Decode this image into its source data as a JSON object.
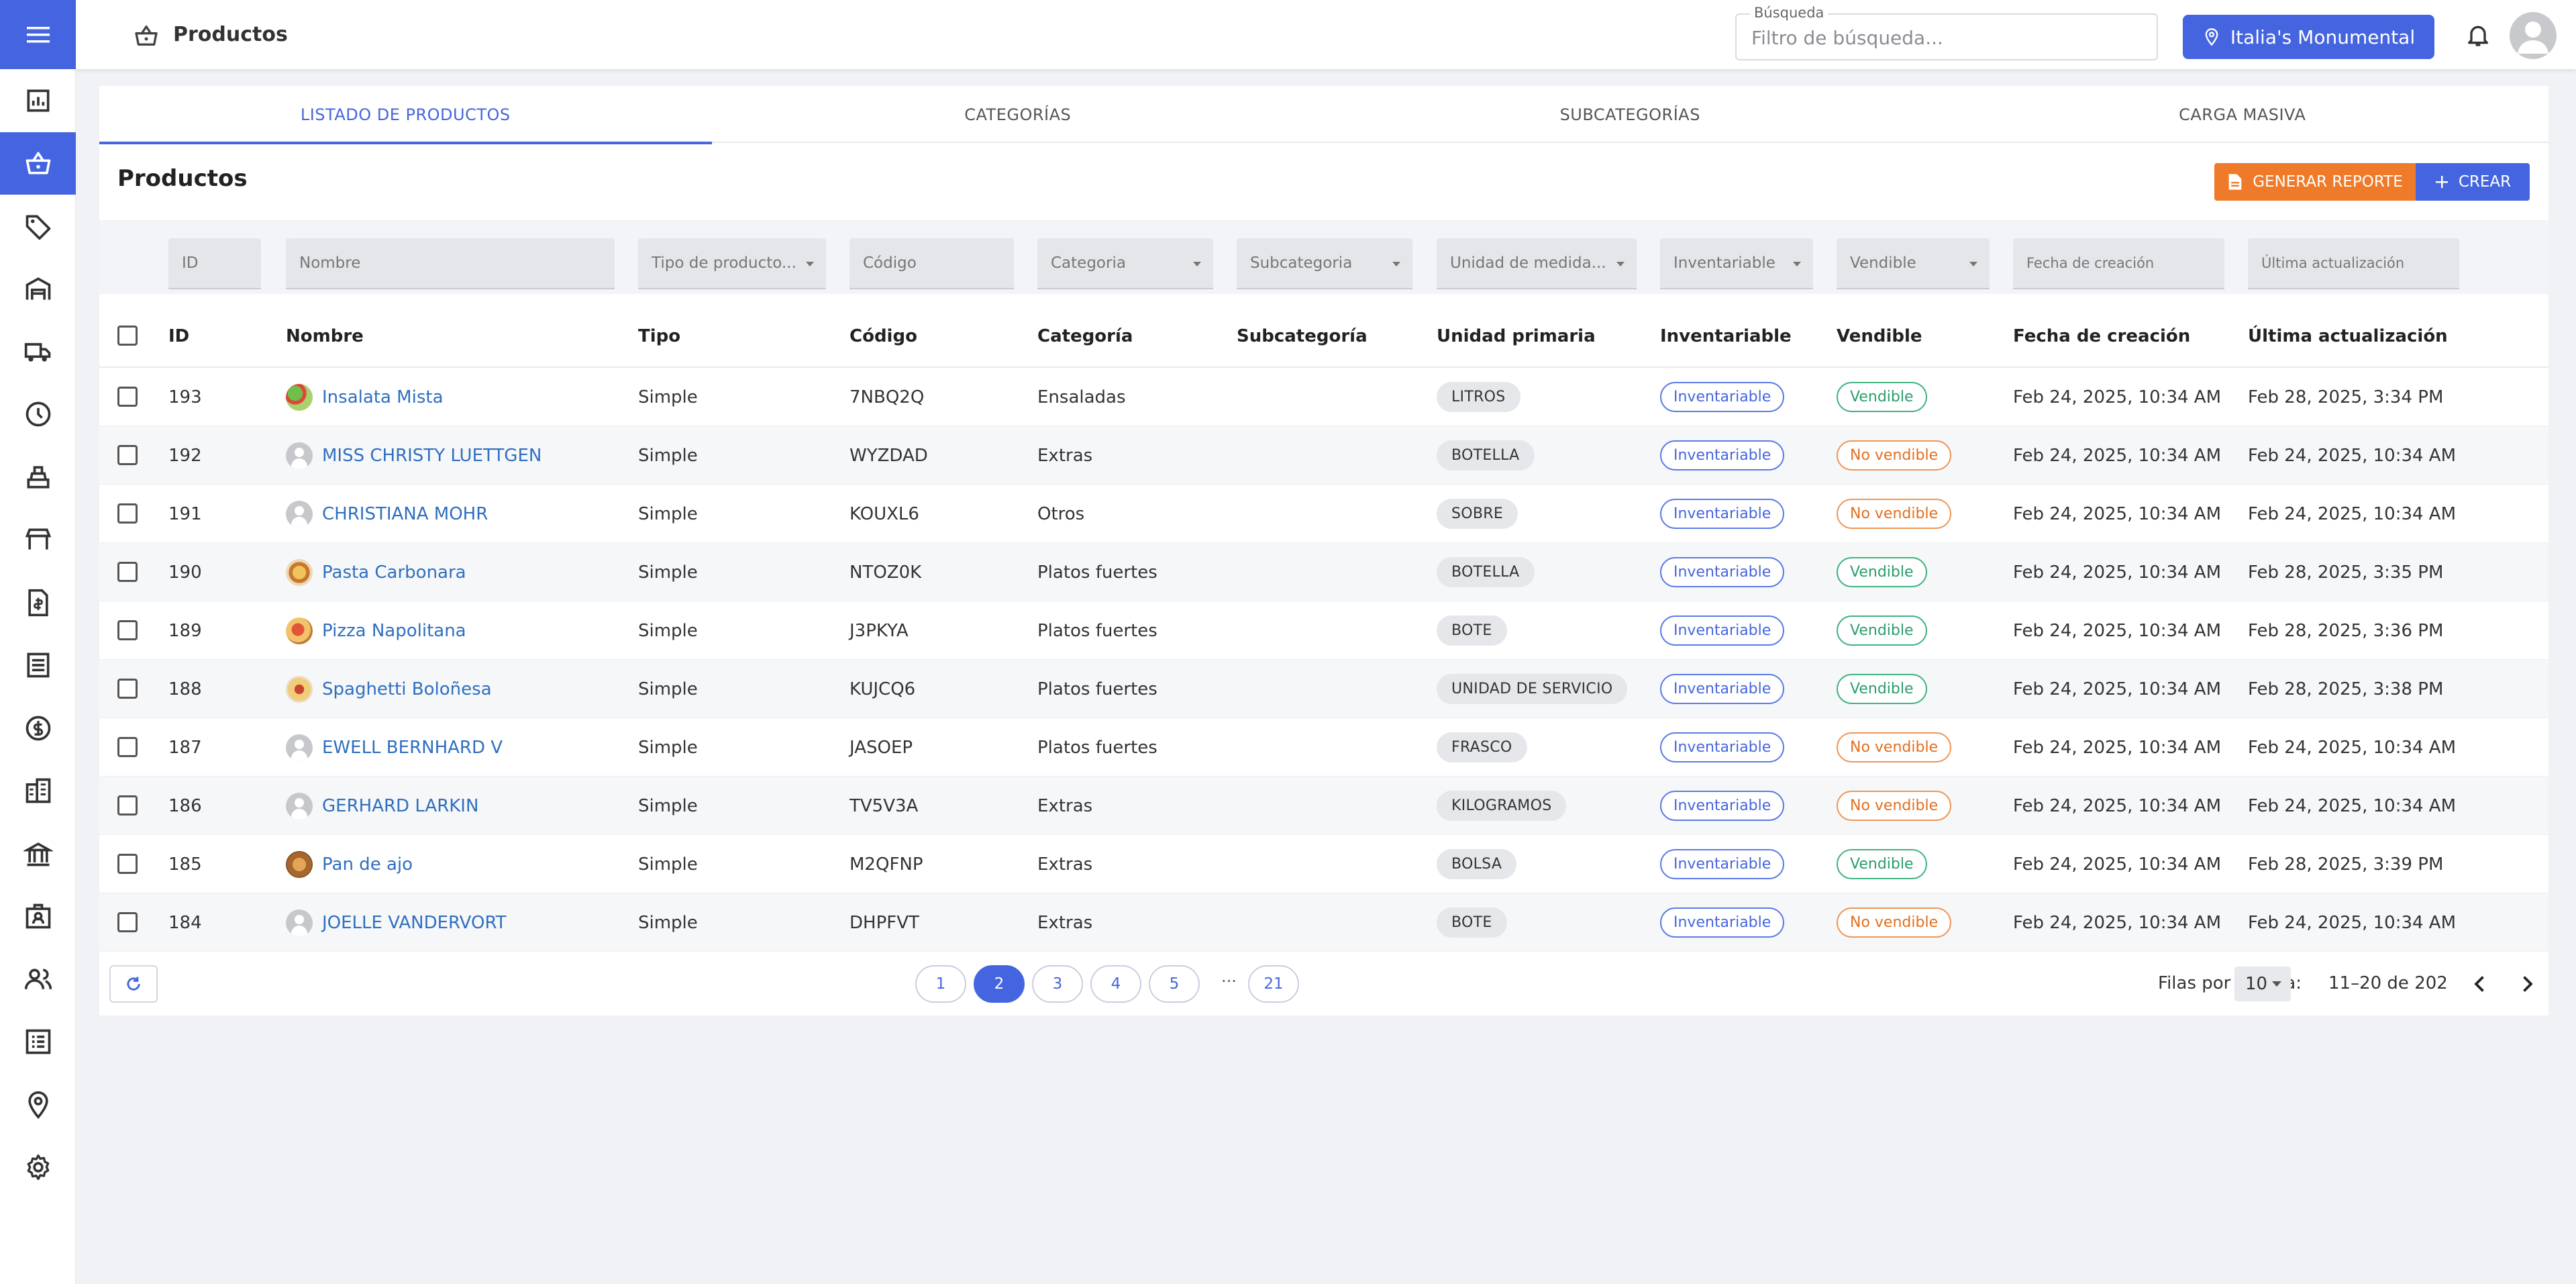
{
  "header": {
    "title": "Productos",
    "search_label": "Búsqueda",
    "search_placeholder": "Filtro de búsqueda...",
    "location": "Italia's Monumental"
  },
  "sidebar": {
    "items": [
      {
        "icon": "chart-icon"
      },
      {
        "icon": "basket-icon",
        "active": true
      },
      {
        "icon": "tag-icon"
      },
      {
        "icon": "warehouse-icon"
      },
      {
        "icon": "truck-icon"
      },
      {
        "icon": "clock-icon"
      },
      {
        "icon": "cash-register-icon"
      },
      {
        "icon": "store-icon"
      },
      {
        "icon": "invoice-icon"
      },
      {
        "icon": "list-icon"
      },
      {
        "icon": "dollar-icon"
      },
      {
        "icon": "building-icon"
      },
      {
        "icon": "bank-icon"
      },
      {
        "icon": "badge-icon"
      },
      {
        "icon": "users-icon"
      },
      {
        "icon": "checklist-icon"
      },
      {
        "icon": "location-pin-icon"
      },
      {
        "icon": "gear-icon"
      }
    ]
  },
  "tabs": [
    "LISTADO DE PRODUCTOS",
    "CATEGORÍAS",
    "SUBCATEGORÍAS",
    "CARGA MASIVA"
  ],
  "main": {
    "title": "Productos",
    "report_label": "GENERAR REPORTE",
    "create_label": "CREAR"
  },
  "filters": {
    "id": "ID",
    "nombre": "Nombre",
    "tipo": "Tipo de producto...",
    "codigo": "Código",
    "categoria": "Categoria",
    "subcategoria": "Subcategoria",
    "unidad": "Unidad de medida...",
    "inventariable": "Inventariable",
    "vendible": "Vendible",
    "fecha_creacion": "Fecha de creación",
    "ultima": "Última actualización"
  },
  "columns": [
    "ID",
    "Nombre",
    "Tipo",
    "Código",
    "Categoría",
    "Subcategoría",
    "Unidad primaria",
    "Inventariable",
    "Vendible",
    "Fecha de creación",
    "Última actualización"
  ],
  "rows": [
    {
      "id": "193",
      "nombre": "Insalata Mista",
      "thumb": "food-salad",
      "tipo": "Simple",
      "codigo": "7NBQ2Q",
      "categoria": "Ensaladas",
      "subcategoria": "",
      "unidad": "LITROS",
      "inventariable": "Inventariable",
      "vendible": "Vendible",
      "vendible_ok": true,
      "creado": "Feb 24, 2025, 10:34 AM",
      "actualizado": "Feb 28, 2025, 3:34 PM"
    },
    {
      "id": "192",
      "nombre": "MISS CHRISTY LUETTGEN",
      "thumb": "person",
      "tipo": "Simple",
      "codigo": "WYZDAD",
      "categoria": "Extras",
      "subcategoria": "",
      "unidad": "BOTELLA",
      "inventariable": "Inventariable",
      "vendible": "No vendible",
      "vendible_ok": false,
      "creado": "Feb 24, 2025, 10:34 AM",
      "actualizado": "Feb 24, 2025, 10:34 AM"
    },
    {
      "id": "191",
      "nombre": "CHRISTIANA MOHR",
      "thumb": "person",
      "tipo": "Simple",
      "codigo": "KOUXL6",
      "categoria": "Otros",
      "subcategoria": "",
      "unidad": "SOBRE",
      "inventariable": "Inventariable",
      "vendible": "No vendible",
      "vendible_ok": false,
      "creado": "Feb 24, 2025, 10:34 AM",
      "actualizado": "Feb 24, 2025, 10:34 AM"
    },
    {
      "id": "190",
      "nombre": "Pasta Carbonara",
      "thumb": "food-pasta",
      "tipo": "Simple",
      "codigo": "NTOZ0K",
      "categoria": "Platos fuertes",
      "subcategoria": "",
      "unidad": "BOTELLA",
      "inventariable": "Inventariable",
      "vendible": "Vendible",
      "vendible_ok": true,
      "creado": "Feb 24, 2025, 10:34 AM",
      "actualizado": "Feb 28, 2025, 3:35 PM"
    },
    {
      "id": "189",
      "nombre": "Pizza Napolitana",
      "thumb": "food-pizza",
      "tipo": "Simple",
      "codigo": "J3PKYA",
      "categoria": "Platos fuertes",
      "subcategoria": "",
      "unidad": "BOTE",
      "inventariable": "Inventariable",
      "vendible": "Vendible",
      "vendible_ok": true,
      "creado": "Feb 24, 2025, 10:34 AM",
      "actualizado": "Feb 28, 2025, 3:36 PM"
    },
    {
      "id": "188",
      "nombre": "Spaghetti Boloñesa",
      "thumb": "food-spaghetti",
      "tipo": "Simple",
      "codigo": "KUJCQ6",
      "categoria": "Platos fuertes",
      "subcategoria": "",
      "unidad": "UNIDAD DE SERVICIO",
      "inventariable": "Inventariable",
      "vendible": "Vendible",
      "vendible_ok": true,
      "creado": "Feb 24, 2025, 10:34 AM",
      "actualizado": "Feb 28, 2025, 3:38 PM"
    },
    {
      "id": "187",
      "nombre": "EWELL BERNHARD V",
      "thumb": "person",
      "tipo": "Simple",
      "codigo": "JASOEP",
      "categoria": "Platos fuertes",
      "subcategoria": "",
      "unidad": "FRASCO",
      "inventariable": "Inventariable",
      "vendible": "No vendible",
      "vendible_ok": false,
      "creado": "Feb 24, 2025, 10:34 AM",
      "actualizado": "Feb 24, 2025, 10:34 AM"
    },
    {
      "id": "186",
      "nombre": "GERHARD LARKIN",
      "thumb": "person",
      "tipo": "Simple",
      "codigo": "TV5V3A",
      "categoria": "Extras",
      "subcategoria": "",
      "unidad": "KILOGRAMOS",
      "inventariable": "Inventariable",
      "vendible": "No vendible",
      "vendible_ok": false,
      "creado": "Feb 24, 2025, 10:34 AM",
      "actualizado": "Feb 24, 2025, 10:34 AM"
    },
    {
      "id": "185",
      "nombre": "Pan de ajo",
      "thumb": "food-bread",
      "tipo": "Simple",
      "codigo": "M2QFNP",
      "categoria": "Extras",
      "subcategoria": "",
      "unidad": "BOLSA",
      "inventariable": "Inventariable",
      "vendible": "Vendible",
      "vendible_ok": true,
      "creado": "Feb 24, 2025, 10:34 AM",
      "actualizado": "Feb 28, 2025, 3:39 PM"
    },
    {
      "id": "184",
      "nombre": "JOELLE VANDERVORT",
      "thumb": "person",
      "tipo": "Simple",
      "codigo": "DHPFVT",
      "categoria": "Extras",
      "subcategoria": "",
      "unidad": "BOTE",
      "inventariable": "Inventariable",
      "vendible": "No vendible",
      "vendible_ok": false,
      "creado": "Feb 24, 2025, 10:34 AM",
      "actualizado": "Feb 24, 2025, 10:34 AM"
    }
  ],
  "pagination": {
    "pages": [
      "1",
      "2",
      "3",
      "4",
      "5",
      "21"
    ],
    "current": "2",
    "ellipsis": "···",
    "rows_per_page_label": "Filas por página:",
    "rows_per_page": "10",
    "range": "11–20 de 202"
  },
  "colors": {
    "accent": "#4565e0",
    "report": "#ef7b2a",
    "vendible": "#2a9d6a",
    "no_vendible": "#e26f1e"
  }
}
